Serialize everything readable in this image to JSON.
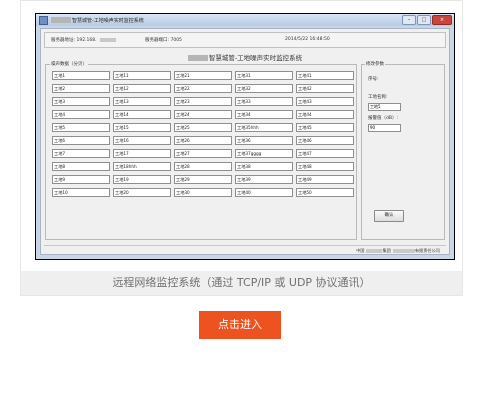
{
  "window": {
    "title": "智慧城管-工地噪声实时监控系统",
    "buttons": {
      "minimize": "–",
      "maximize": "□",
      "close": "×"
    }
  },
  "info": {
    "server_addr_label": "服务器地址:",
    "server_addr_value": "192.168.",
    "server_port_label": "服务器端口:",
    "server_port_value": "7005",
    "datetime": "2014/5/22 16:48:50"
  },
  "main_title": "智慧城管-工地噪声实时监控系统",
  "noise_panel": {
    "legend": "噪声数据（分贝）",
    "rows": [
      [
        "工地1",
        "工地11",
        "工地21",
        "工地31",
        "工地41"
      ],
      [
        "工地2",
        "工地12",
        "工地22",
        "工地32",
        "工地42"
      ],
      [
        "工地3",
        "工地13",
        "工地23",
        "工地33",
        "工地43"
      ],
      [
        "工地4",
        "工地14",
        "工地24",
        "工地34",
        "工地44"
      ],
      [
        "工地5",
        "工地15",
        "工地25",
        "工地35hhh",
        "工地45"
      ],
      [
        "工地6",
        "工地16",
        "工地26",
        "工地36",
        "工地46"
      ],
      [
        "工地7",
        "工地17",
        "工地27",
        "工地37gggg",
        "工地47"
      ],
      [
        "工地8",
        "工地18hhh",
        "工地28",
        "工地38",
        "工地48"
      ],
      [
        "工地9",
        "工地19",
        "工地29",
        "工地39",
        "工地49"
      ],
      [
        "工地10",
        "工地20",
        "工地30",
        "工地40",
        "工地50"
      ]
    ]
  },
  "params_panel": {
    "legend": "修改参数",
    "seq_label": "序号:",
    "seq_value": "",
    "site_name_label": "工地名称:",
    "site_name_value": "工地5",
    "threshold_label": "报警值（dB）:",
    "threshold_value": "90",
    "confirm_label": "确认"
  },
  "status": {
    "company": "有限责任公司",
    "prefix": "中国",
    "mid": "集团"
  },
  "caption": "远程网络监控系统（通过 TCP/IP 或 UDP 协议通讯）",
  "cta": {
    "label": "点击进入"
  },
  "colors": {
    "accent": "#ec5320",
    "caption_bg": "#efefef"
  }
}
